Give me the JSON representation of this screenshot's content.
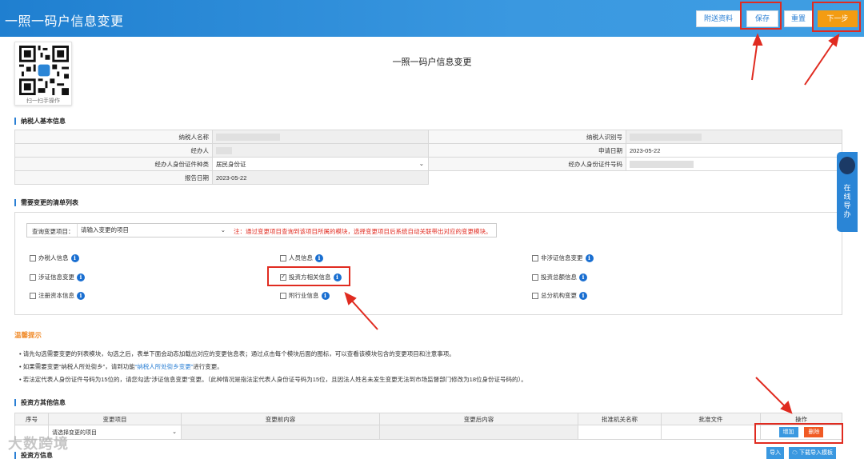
{
  "header": {
    "title": "一照一码户信息变更",
    "buttons": {
      "attach": "附送资料",
      "save": "保存",
      "reset": "重置",
      "next": "下一步"
    }
  },
  "qr": {
    "caption": "扫一扫手操作"
  },
  "page_title": "一照一码户信息变更",
  "basic": {
    "section_title": "纳税人基本信息",
    "rows": [
      {
        "l1": "纳税人名称",
        "v1": "",
        "l2": "纳税人识别号",
        "v2": ""
      },
      {
        "l1": "经办人",
        "v1": "",
        "l2": "申请日期",
        "v2": "2023-05-22"
      },
      {
        "l1": "经办人身份证件种类",
        "v1": "居民身份证",
        "l2": "经办人身份证件号码",
        "v2": ""
      },
      {
        "l1": "报告日期",
        "v1": "2023-05-22"
      }
    ]
  },
  "change_list": {
    "section_title": "需要变更的清单列表",
    "query_label": "查询变更项目：",
    "query_value": "请输入变更的项目",
    "query_note": "注：通过变更项目查询到该项目所属的模块，选择变更项目后系统自动关联带出对应的变更模块。",
    "options": [
      {
        "label": "办税人信息",
        "checked": false
      },
      {
        "label": "人员信息",
        "checked": false
      },
      {
        "label": "非涉证信息变更",
        "checked": false
      },
      {
        "label": "涉证信息变更",
        "checked": false
      },
      {
        "label": "投资方相关信息",
        "checked": true
      },
      {
        "label": "投资总额信息",
        "checked": false
      },
      {
        "label": "注册资本信息",
        "checked": false
      },
      {
        "label": "附行业信息",
        "checked": false
      },
      {
        "label": "总分机构变更",
        "checked": false
      }
    ]
  },
  "tips": {
    "title": "温馨提示",
    "t1": "请先勾选需要变更的列表模块，勾选之后，表单下面会动态加载出对应的变更信息表；通过点击每个模块后面的图标，可以查看该模块包含的变更项目和注意事项。",
    "t2_pre": "如果需要变更“纳税人所处街乡”，请到功能",
    "t2_link": "“纳税人所处街乡变更”",
    "t2_post": "进行变更。",
    "t3": "若法定代表人身份证件号码为15位的，请您勾选“涉证信息变更”变更。（此种情况是指法定代表人身份证号码为15位，且因法人姓名未发生变更无法到市场监督部门修改为18位身份证号码的）。"
  },
  "investor_other": {
    "section_title": "投资方其他信息",
    "columns": [
      "序号",
      "变更项目",
      "变更前内容",
      "变更后内容",
      "批准机关名称",
      "批准文件",
      "操作"
    ],
    "row_select": "请选择变更的项目",
    "add": "增加",
    "delete": "删除"
  },
  "investor_info": {
    "section_title": "投资方信息"
  },
  "import": {
    "import_label": "导入",
    "template_label": "下载导入模板"
  },
  "guide": {
    "text": "在线导办"
  },
  "watermark": "大数跨境",
  "colors": {
    "header_blue": "#2a85d6",
    "next_orange": "#f39c12",
    "annotation_red": "#e02b20",
    "info_blue": "#1a6fd1"
  }
}
